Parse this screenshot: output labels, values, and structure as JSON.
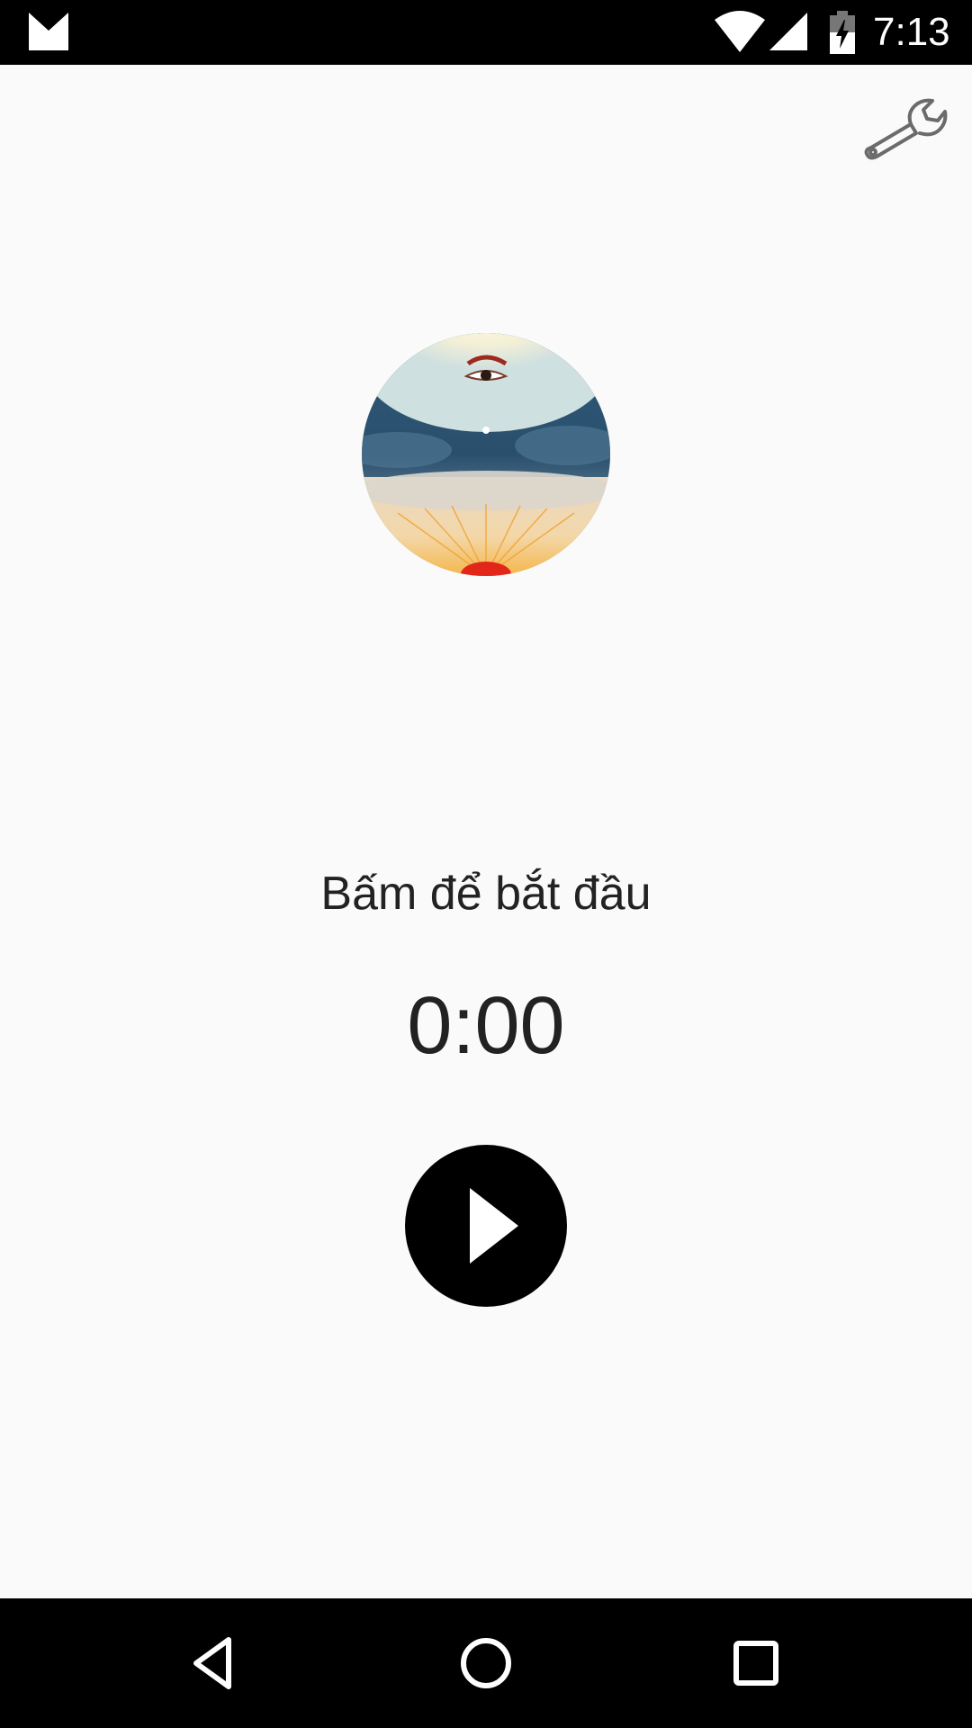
{
  "status_bar": {
    "time": "7:13",
    "icons": [
      "gmail-icon",
      "wifi-icon",
      "cell-signal-icon",
      "battery-charging-icon"
    ]
  },
  "toolbar": {
    "settings_icon": "wrench-icon"
  },
  "artwork": {
    "icon": "eye-sky-sun-artwork"
  },
  "main": {
    "prompt": "Bấm để bắt đầu",
    "timer": "0:00",
    "play_icon": "play-icon"
  },
  "nav_bar": {
    "icons": [
      "back-icon",
      "home-icon",
      "recents-icon"
    ]
  },
  "colors": {
    "background": "#fafafa",
    "text": "#222222",
    "bars": "#000000",
    "play_button": "#000000"
  }
}
